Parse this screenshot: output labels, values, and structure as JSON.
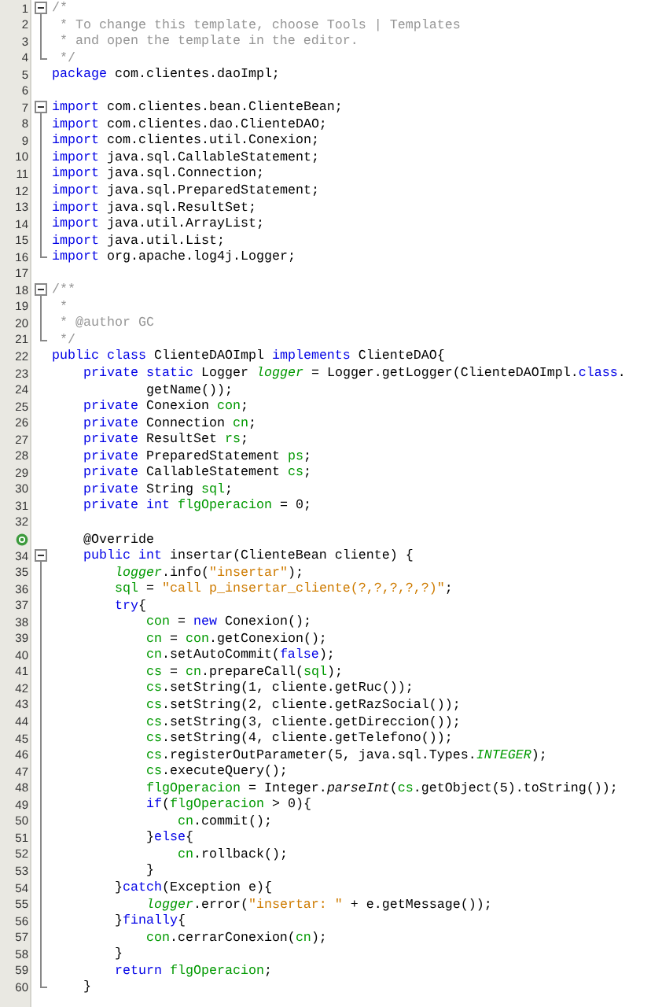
{
  "editor": {
    "lines": [
      {
        "number": "1",
        "fold_open": true,
        "tokens": [
          {
            "kind": "comment",
            "text": "/*"
          }
        ]
      },
      {
        "number": "2",
        "tokens": [
          {
            "kind": "comment",
            "text": " * To change this template, choose Tools | Templates"
          }
        ]
      },
      {
        "number": "3",
        "tokens": [
          {
            "kind": "comment",
            "text": " * and open the template in the editor."
          }
        ]
      },
      {
        "number": "4",
        "fold_close": true,
        "tokens": [
          {
            "kind": "comment",
            "text": " */"
          }
        ]
      },
      {
        "number": "5",
        "tokens": [
          {
            "kind": "keyword",
            "text": "package"
          },
          {
            "kind": "plain",
            "text": " com.clientes.daoImpl;"
          }
        ]
      },
      {
        "number": "6"
      },
      {
        "number": "7",
        "fold_open": true,
        "tokens": [
          {
            "kind": "keyword",
            "text": "import"
          },
          {
            "kind": "plain",
            "text": " com.clientes.bean.ClienteBean;"
          }
        ]
      },
      {
        "number": "8",
        "tokens": [
          {
            "kind": "keyword",
            "text": "import"
          },
          {
            "kind": "plain",
            "text": " com.clientes.dao.ClienteDAO;"
          }
        ]
      },
      {
        "number": "9",
        "tokens": [
          {
            "kind": "keyword",
            "text": "import"
          },
          {
            "kind": "plain",
            "text": " com.clientes.util.Conexion;"
          }
        ]
      },
      {
        "number": "10",
        "tokens": [
          {
            "kind": "keyword",
            "text": "import"
          },
          {
            "kind": "plain",
            "text": " java.sql.CallableStatement;"
          }
        ]
      },
      {
        "number": "11",
        "tokens": [
          {
            "kind": "keyword",
            "text": "import"
          },
          {
            "kind": "plain",
            "text": " java.sql.Connection;"
          }
        ]
      },
      {
        "number": "12",
        "tokens": [
          {
            "kind": "keyword",
            "text": "import"
          },
          {
            "kind": "plain",
            "text": " java.sql.PreparedStatement;"
          }
        ]
      },
      {
        "number": "13",
        "tokens": [
          {
            "kind": "keyword",
            "text": "import"
          },
          {
            "kind": "plain",
            "text": " java.sql.ResultSet;"
          }
        ]
      },
      {
        "number": "14",
        "tokens": [
          {
            "kind": "keyword",
            "text": "import"
          },
          {
            "kind": "plain",
            "text": " java.util.ArrayList;"
          }
        ]
      },
      {
        "number": "15",
        "tokens": [
          {
            "kind": "keyword",
            "text": "import"
          },
          {
            "kind": "plain",
            "text": " java.util.List;"
          }
        ]
      },
      {
        "number": "16",
        "fold_close": true,
        "tokens": [
          {
            "kind": "keyword",
            "text": "import"
          },
          {
            "kind": "plain",
            "text": " org.apache.log4j.Logger;"
          }
        ]
      },
      {
        "number": "17"
      },
      {
        "number": "18",
        "fold_open": true,
        "tokens": [
          {
            "kind": "comment",
            "text": "/**"
          }
        ]
      },
      {
        "number": "19",
        "tokens": [
          {
            "kind": "comment",
            "text": " *"
          }
        ]
      },
      {
        "number": "20",
        "tokens": [
          {
            "kind": "comment",
            "text": " * @author GC"
          }
        ]
      },
      {
        "number": "21",
        "fold_close": true,
        "tokens": [
          {
            "kind": "comment",
            "text": " */"
          }
        ]
      },
      {
        "number": "22",
        "tokens": [
          {
            "kind": "keyword",
            "text": "public class"
          },
          {
            "kind": "plain",
            "text": " ClienteDAOImpl "
          },
          {
            "kind": "keyword",
            "text": "implements"
          },
          {
            "kind": "plain",
            "text": " ClienteDAO{"
          }
        ]
      },
      {
        "number": "23",
        "tokens": [
          {
            "kind": "keyword",
            "text": "    private static"
          },
          {
            "kind": "plain",
            "text": " Logger "
          },
          {
            "kind": "static-field",
            "text": "logger"
          },
          {
            "kind": "plain",
            "text": " = Logger.getLogger(ClienteDAOImpl."
          },
          {
            "kind": "keyword",
            "text": "class"
          },
          {
            "kind": "plain",
            "text": "."
          }
        ]
      },
      {
        "number": "24",
        "tokens": [
          {
            "kind": "plain",
            "text": "            getName());"
          }
        ]
      },
      {
        "number": "25",
        "tokens": [
          {
            "kind": "keyword",
            "text": "    private"
          },
          {
            "kind": "plain",
            "text": " Conexion "
          },
          {
            "kind": "field",
            "text": "con"
          },
          {
            "kind": "plain",
            "text": ";"
          }
        ]
      },
      {
        "number": "26",
        "tokens": [
          {
            "kind": "keyword",
            "text": "    private"
          },
          {
            "kind": "plain",
            "text": " Connection "
          },
          {
            "kind": "field",
            "text": "cn"
          },
          {
            "kind": "plain",
            "text": ";"
          }
        ]
      },
      {
        "number": "27",
        "tokens": [
          {
            "kind": "keyword",
            "text": "    private"
          },
          {
            "kind": "plain",
            "text": " ResultSet "
          },
          {
            "kind": "field",
            "text": "rs"
          },
          {
            "kind": "plain",
            "text": ";"
          }
        ]
      },
      {
        "number": "28",
        "tokens": [
          {
            "kind": "keyword",
            "text": "    private"
          },
          {
            "kind": "plain",
            "text": " PreparedStatement "
          },
          {
            "kind": "field",
            "text": "ps"
          },
          {
            "kind": "plain",
            "text": ";"
          }
        ]
      },
      {
        "number": "29",
        "tokens": [
          {
            "kind": "keyword",
            "text": "    private"
          },
          {
            "kind": "plain",
            "text": " CallableStatement "
          },
          {
            "kind": "field",
            "text": "cs"
          },
          {
            "kind": "plain",
            "text": ";"
          }
        ]
      },
      {
        "number": "30",
        "tokens": [
          {
            "kind": "keyword",
            "text": "    private"
          },
          {
            "kind": "plain",
            "text": " String "
          },
          {
            "kind": "field",
            "text": "sql"
          },
          {
            "kind": "plain",
            "text": ";"
          }
        ]
      },
      {
        "number": "31",
        "tokens": [
          {
            "kind": "keyword",
            "text": "    private int"
          },
          {
            "kind": "field",
            "text": " flgOperacion"
          },
          {
            "kind": "plain",
            "text": " = 0;"
          }
        ]
      },
      {
        "number": "32"
      },
      {
        "override": true,
        "tokens": [
          {
            "kind": "plain",
            "text": "    @Override"
          }
        ]
      },
      {
        "number": "34",
        "fold_open": true,
        "tokens": [
          {
            "kind": "keyword",
            "text": "    public int"
          },
          {
            "kind": "plain",
            "text": " insertar(ClienteBean cliente) {"
          }
        ]
      },
      {
        "number": "35",
        "tokens": [
          {
            "kind": "static-field",
            "text": "        logger"
          },
          {
            "kind": "plain",
            "text": ".info("
          },
          {
            "kind": "string",
            "text": "\"insertar\""
          },
          {
            "kind": "plain",
            "text": ");"
          }
        ]
      },
      {
        "number": "36",
        "tokens": [
          {
            "kind": "field",
            "text": "        sql"
          },
          {
            "kind": "plain",
            "text": " = "
          },
          {
            "kind": "string",
            "text": "\"call p_insertar_cliente(?,?,?,?,?)\""
          },
          {
            "kind": "plain",
            "text": ";"
          }
        ]
      },
      {
        "number": "37",
        "tokens": [
          {
            "kind": "keyword",
            "text": "        try"
          },
          {
            "kind": "plain",
            "text": "{"
          }
        ]
      },
      {
        "number": "38",
        "tokens": [
          {
            "kind": "field",
            "text": "            con"
          },
          {
            "kind": "plain",
            "text": " = "
          },
          {
            "kind": "keyword",
            "text": "new"
          },
          {
            "kind": "plain",
            "text": " Conexion();"
          }
        ]
      },
      {
        "number": "39",
        "tokens": [
          {
            "kind": "field",
            "text": "            cn"
          },
          {
            "kind": "plain",
            "text": " = "
          },
          {
            "kind": "field",
            "text": "con"
          },
          {
            "kind": "plain",
            "text": ".getConexion();"
          }
        ]
      },
      {
        "number": "40",
        "tokens": [
          {
            "kind": "field",
            "text": "            cn"
          },
          {
            "kind": "plain",
            "text": ".setAutoCommit("
          },
          {
            "kind": "keyword",
            "text": "false"
          },
          {
            "kind": "plain",
            "text": ");"
          }
        ]
      },
      {
        "number": "41",
        "tokens": [
          {
            "kind": "field",
            "text": "            cs"
          },
          {
            "kind": "plain",
            "text": " = "
          },
          {
            "kind": "field",
            "text": "cn"
          },
          {
            "kind": "plain",
            "text": ".prepareCall("
          },
          {
            "kind": "field",
            "text": "sql"
          },
          {
            "kind": "plain",
            "text": ");"
          }
        ]
      },
      {
        "number": "42",
        "tokens": [
          {
            "kind": "field",
            "text": "            cs"
          },
          {
            "kind": "plain",
            "text": ".setString(1, cliente.getRuc());"
          }
        ]
      },
      {
        "number": "43",
        "tokens": [
          {
            "kind": "field",
            "text": "            cs"
          },
          {
            "kind": "plain",
            "text": ".setString(2, cliente.getRazSocial());"
          }
        ]
      },
      {
        "number": "44",
        "tokens": [
          {
            "kind": "field",
            "text": "            cs"
          },
          {
            "kind": "plain",
            "text": ".setString(3, cliente.getDireccion());"
          }
        ]
      },
      {
        "number": "45",
        "tokens": [
          {
            "kind": "field",
            "text": "            cs"
          },
          {
            "kind": "plain",
            "text": ".setString(4, cliente.getTelefono());"
          }
        ]
      },
      {
        "number": "46",
        "tokens": [
          {
            "kind": "field",
            "text": "            cs"
          },
          {
            "kind": "plain",
            "text": ".registerOutParameter(5, java.sql.Types."
          },
          {
            "kind": "static-field",
            "text": "INTEGER"
          },
          {
            "kind": "plain",
            "text": ");"
          }
        ]
      },
      {
        "number": "47",
        "tokens": [
          {
            "kind": "field",
            "text": "            cs"
          },
          {
            "kind": "plain",
            "text": ".executeQuery();"
          }
        ]
      },
      {
        "number": "48",
        "tokens": [
          {
            "kind": "field",
            "text": "            flgOperacion"
          },
          {
            "kind": "plain",
            "text": " = Integer."
          },
          {
            "kind": "static-method",
            "text": "parseInt"
          },
          {
            "kind": "plain",
            "text": "("
          },
          {
            "kind": "field",
            "text": "cs"
          },
          {
            "kind": "plain",
            "text": ".getObject(5).toString());"
          }
        ]
      },
      {
        "number": "49",
        "tokens": [
          {
            "kind": "keyword",
            "text": "            if"
          },
          {
            "kind": "plain",
            "text": "("
          },
          {
            "kind": "field",
            "text": "flgOperacion"
          },
          {
            "kind": "plain",
            "text": " > 0){"
          }
        ]
      },
      {
        "number": "50",
        "tokens": [
          {
            "kind": "field",
            "text": "                cn"
          },
          {
            "kind": "plain",
            "text": ".commit();"
          }
        ]
      },
      {
        "number": "51",
        "tokens": [
          {
            "kind": "plain",
            "text": "            }"
          },
          {
            "kind": "keyword",
            "text": "else"
          },
          {
            "kind": "plain",
            "text": "{"
          }
        ]
      },
      {
        "number": "52",
        "tokens": [
          {
            "kind": "field",
            "text": "                cn"
          },
          {
            "kind": "plain",
            "text": ".rollback();"
          }
        ]
      },
      {
        "number": "53",
        "tokens": [
          {
            "kind": "plain",
            "text": "            }"
          }
        ]
      },
      {
        "number": "54",
        "tokens": [
          {
            "kind": "plain",
            "text": "        }"
          },
          {
            "kind": "keyword",
            "text": "catch"
          },
          {
            "kind": "plain",
            "text": "(Exception e){"
          }
        ]
      },
      {
        "number": "55",
        "tokens": [
          {
            "kind": "static-field",
            "text": "            logger"
          },
          {
            "kind": "plain",
            "text": ".error("
          },
          {
            "kind": "string",
            "text": "\"insertar: \""
          },
          {
            "kind": "plain",
            "text": " + e.getMessage());"
          }
        ]
      },
      {
        "number": "56",
        "tokens": [
          {
            "kind": "plain",
            "text": "        }"
          },
          {
            "kind": "keyword",
            "text": "finally"
          },
          {
            "kind": "plain",
            "text": "{"
          }
        ]
      },
      {
        "number": "57",
        "tokens": [
          {
            "kind": "field",
            "text": "            con"
          },
          {
            "kind": "plain",
            "text": ".cerrarConexion("
          },
          {
            "kind": "field",
            "text": "cn"
          },
          {
            "kind": "plain",
            "text": ");"
          }
        ]
      },
      {
        "number": "58",
        "tokens": [
          {
            "kind": "plain",
            "text": "        }"
          }
        ]
      },
      {
        "number": "59",
        "tokens": [
          {
            "kind": "keyword",
            "text": "        return"
          },
          {
            "kind": "field",
            "text": " flgOperacion"
          },
          {
            "kind": "plain",
            "text": ";"
          }
        ]
      },
      {
        "number": "60",
        "fold_close": true,
        "tokens": [
          {
            "kind": "plain",
            "text": "    }"
          }
        ]
      }
    ]
  }
}
